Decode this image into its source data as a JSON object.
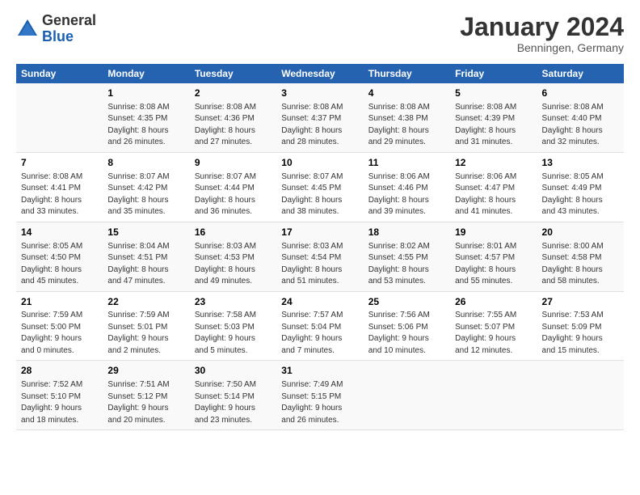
{
  "logo": {
    "general": "General",
    "blue": "Blue"
  },
  "title": "January 2024",
  "location": "Benningen, Germany",
  "days_header": [
    "Sunday",
    "Monday",
    "Tuesday",
    "Wednesday",
    "Thursday",
    "Friday",
    "Saturday"
  ],
  "weeks": [
    [
      {
        "day": "",
        "info": ""
      },
      {
        "day": "1",
        "info": "Sunrise: 8:08 AM\nSunset: 4:35 PM\nDaylight: 8 hours\nand 26 minutes."
      },
      {
        "day": "2",
        "info": "Sunrise: 8:08 AM\nSunset: 4:36 PM\nDaylight: 8 hours\nand 27 minutes."
      },
      {
        "day": "3",
        "info": "Sunrise: 8:08 AM\nSunset: 4:37 PM\nDaylight: 8 hours\nand 28 minutes."
      },
      {
        "day": "4",
        "info": "Sunrise: 8:08 AM\nSunset: 4:38 PM\nDaylight: 8 hours\nand 29 minutes."
      },
      {
        "day": "5",
        "info": "Sunrise: 8:08 AM\nSunset: 4:39 PM\nDaylight: 8 hours\nand 31 minutes."
      },
      {
        "day": "6",
        "info": "Sunrise: 8:08 AM\nSunset: 4:40 PM\nDaylight: 8 hours\nand 32 minutes."
      }
    ],
    [
      {
        "day": "7",
        "info": "Sunrise: 8:08 AM\nSunset: 4:41 PM\nDaylight: 8 hours\nand 33 minutes."
      },
      {
        "day": "8",
        "info": "Sunrise: 8:07 AM\nSunset: 4:42 PM\nDaylight: 8 hours\nand 35 minutes."
      },
      {
        "day": "9",
        "info": "Sunrise: 8:07 AM\nSunset: 4:44 PM\nDaylight: 8 hours\nand 36 minutes."
      },
      {
        "day": "10",
        "info": "Sunrise: 8:07 AM\nSunset: 4:45 PM\nDaylight: 8 hours\nand 38 minutes."
      },
      {
        "day": "11",
        "info": "Sunrise: 8:06 AM\nSunset: 4:46 PM\nDaylight: 8 hours\nand 39 minutes."
      },
      {
        "day": "12",
        "info": "Sunrise: 8:06 AM\nSunset: 4:47 PM\nDaylight: 8 hours\nand 41 minutes."
      },
      {
        "day": "13",
        "info": "Sunrise: 8:05 AM\nSunset: 4:49 PM\nDaylight: 8 hours\nand 43 minutes."
      }
    ],
    [
      {
        "day": "14",
        "info": "Sunrise: 8:05 AM\nSunset: 4:50 PM\nDaylight: 8 hours\nand 45 minutes."
      },
      {
        "day": "15",
        "info": "Sunrise: 8:04 AM\nSunset: 4:51 PM\nDaylight: 8 hours\nand 47 minutes."
      },
      {
        "day": "16",
        "info": "Sunrise: 8:03 AM\nSunset: 4:53 PM\nDaylight: 8 hours\nand 49 minutes."
      },
      {
        "day": "17",
        "info": "Sunrise: 8:03 AM\nSunset: 4:54 PM\nDaylight: 8 hours\nand 51 minutes."
      },
      {
        "day": "18",
        "info": "Sunrise: 8:02 AM\nSunset: 4:55 PM\nDaylight: 8 hours\nand 53 minutes."
      },
      {
        "day": "19",
        "info": "Sunrise: 8:01 AM\nSunset: 4:57 PM\nDaylight: 8 hours\nand 55 minutes."
      },
      {
        "day": "20",
        "info": "Sunrise: 8:00 AM\nSunset: 4:58 PM\nDaylight: 8 hours\nand 58 minutes."
      }
    ],
    [
      {
        "day": "21",
        "info": "Sunrise: 7:59 AM\nSunset: 5:00 PM\nDaylight: 9 hours\nand 0 minutes."
      },
      {
        "day": "22",
        "info": "Sunrise: 7:59 AM\nSunset: 5:01 PM\nDaylight: 9 hours\nand 2 minutes."
      },
      {
        "day": "23",
        "info": "Sunrise: 7:58 AM\nSunset: 5:03 PM\nDaylight: 9 hours\nand 5 minutes."
      },
      {
        "day": "24",
        "info": "Sunrise: 7:57 AM\nSunset: 5:04 PM\nDaylight: 9 hours\nand 7 minutes."
      },
      {
        "day": "25",
        "info": "Sunrise: 7:56 AM\nSunset: 5:06 PM\nDaylight: 9 hours\nand 10 minutes."
      },
      {
        "day": "26",
        "info": "Sunrise: 7:55 AM\nSunset: 5:07 PM\nDaylight: 9 hours\nand 12 minutes."
      },
      {
        "day": "27",
        "info": "Sunrise: 7:53 AM\nSunset: 5:09 PM\nDaylight: 9 hours\nand 15 minutes."
      }
    ],
    [
      {
        "day": "28",
        "info": "Sunrise: 7:52 AM\nSunset: 5:10 PM\nDaylight: 9 hours\nand 18 minutes."
      },
      {
        "day": "29",
        "info": "Sunrise: 7:51 AM\nSunset: 5:12 PM\nDaylight: 9 hours\nand 20 minutes."
      },
      {
        "day": "30",
        "info": "Sunrise: 7:50 AM\nSunset: 5:14 PM\nDaylight: 9 hours\nand 23 minutes."
      },
      {
        "day": "31",
        "info": "Sunrise: 7:49 AM\nSunset: 5:15 PM\nDaylight: 9 hours\nand 26 minutes."
      },
      {
        "day": "",
        "info": ""
      },
      {
        "day": "",
        "info": ""
      },
      {
        "day": "",
        "info": ""
      }
    ]
  ]
}
